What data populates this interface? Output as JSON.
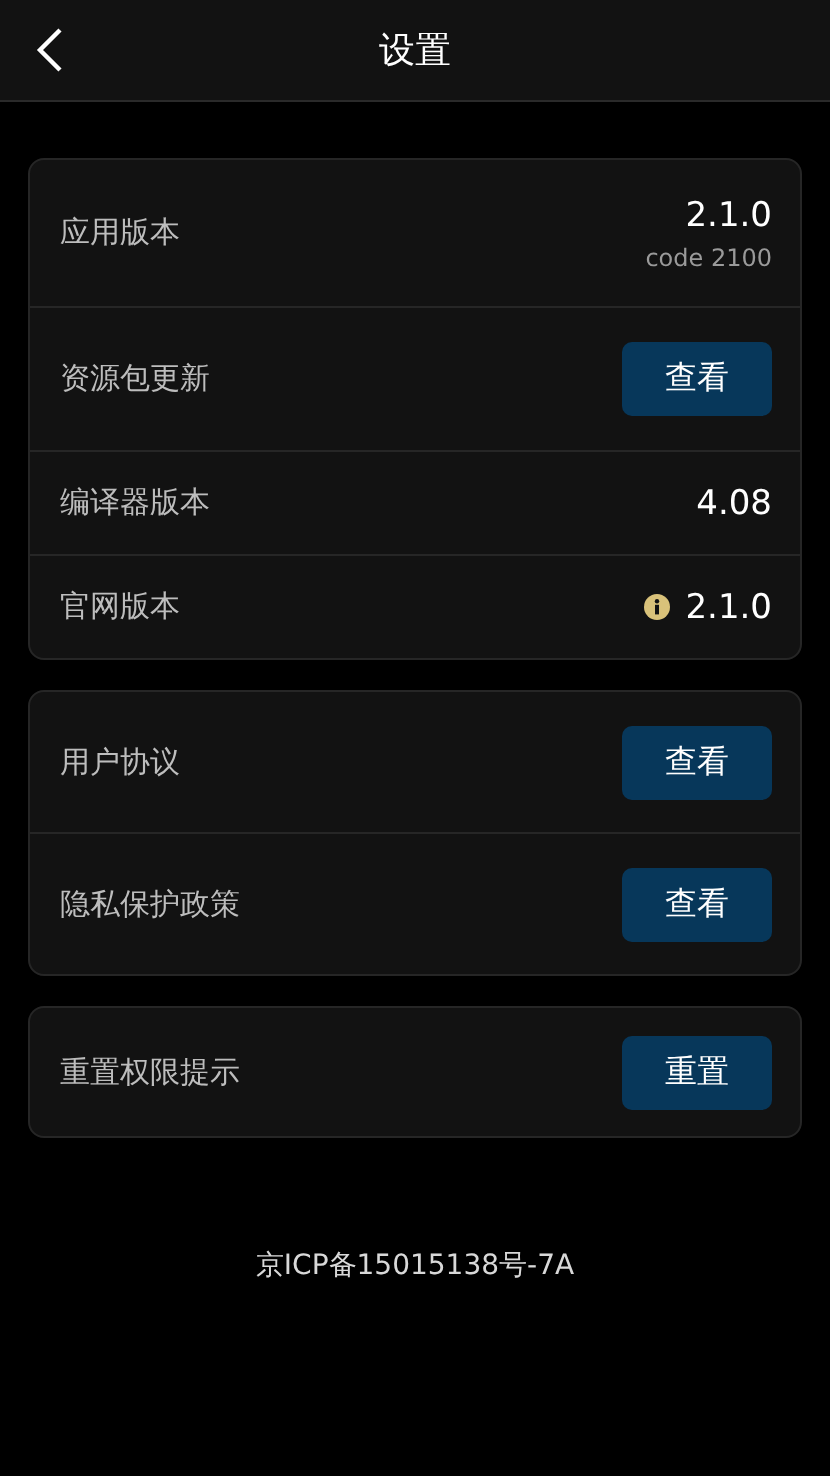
{
  "header": {
    "title": "设置"
  },
  "groups": [
    {
      "rows": [
        {
          "kind": "value",
          "label": "应用版本",
          "value": "2.1.0",
          "sub": "code 2100",
          "info": false
        },
        {
          "kind": "button",
          "label": "资源包更新",
          "button": "查看"
        },
        {
          "kind": "value",
          "label": "编译器版本",
          "value": "4.08",
          "info": false
        },
        {
          "kind": "value",
          "label": "官网版本",
          "value": "2.1.0",
          "info": true
        }
      ]
    },
    {
      "rows": [
        {
          "kind": "button",
          "label": "用户协议",
          "button": "查看"
        },
        {
          "kind": "button",
          "label": "隐私保护政策",
          "button": "查看"
        }
      ]
    },
    {
      "rows": [
        {
          "kind": "button",
          "label": "重置权限提示",
          "button": "重置"
        }
      ]
    }
  ],
  "footer": "京ICP备15015138号-7A"
}
